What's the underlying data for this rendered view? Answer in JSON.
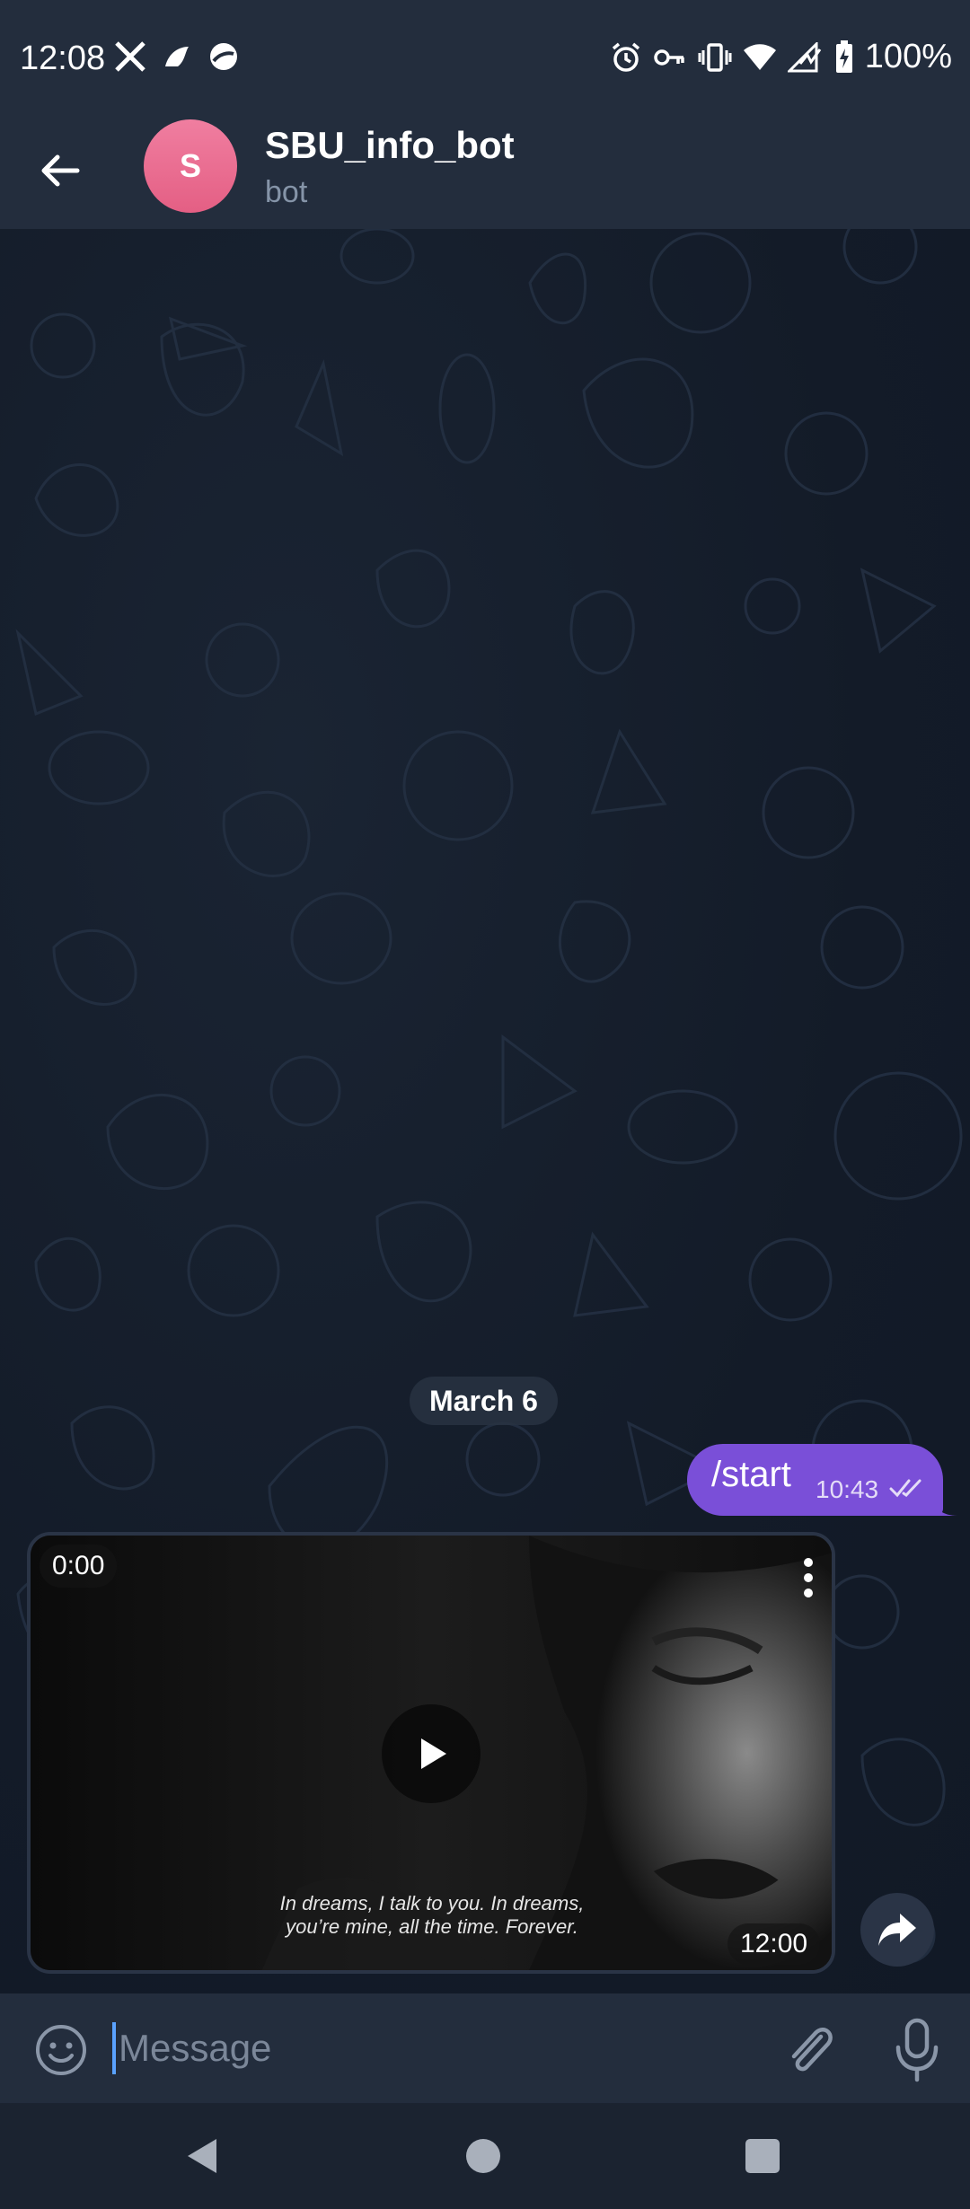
{
  "status_bar": {
    "time": "12:08",
    "battery": "100%",
    "left_icons": [
      "x-app-icon",
      "bird-app-icon",
      "browser-app-icon"
    ],
    "right_icons": [
      "alarm-icon",
      "vpn-key-icon",
      "vibrate-icon",
      "wifi-icon",
      "signal-icon",
      "battery-charging-icon"
    ]
  },
  "header": {
    "avatar_letter": "S",
    "title": "SBU_info_bot",
    "subtitle": "bot",
    "avatar_color": "#e8668c"
  },
  "chat": {
    "date_label": "March 6",
    "outgoing_message": {
      "text": "/start",
      "time": "10:43",
      "status": "read",
      "bubble_color": "#7a4fd8"
    },
    "video_message": {
      "duration_label": "0:00",
      "subtitle_line1": "In dreams, I talk to you. In dreams,",
      "subtitle_line2": "you’re mine, all the time. Forever.",
      "time": "12:00"
    }
  },
  "input": {
    "placeholder": "Message"
  },
  "colors": {
    "bar_background": "#232d3d",
    "chat_background": "#141d2a",
    "accent": "#7a4fd8"
  }
}
